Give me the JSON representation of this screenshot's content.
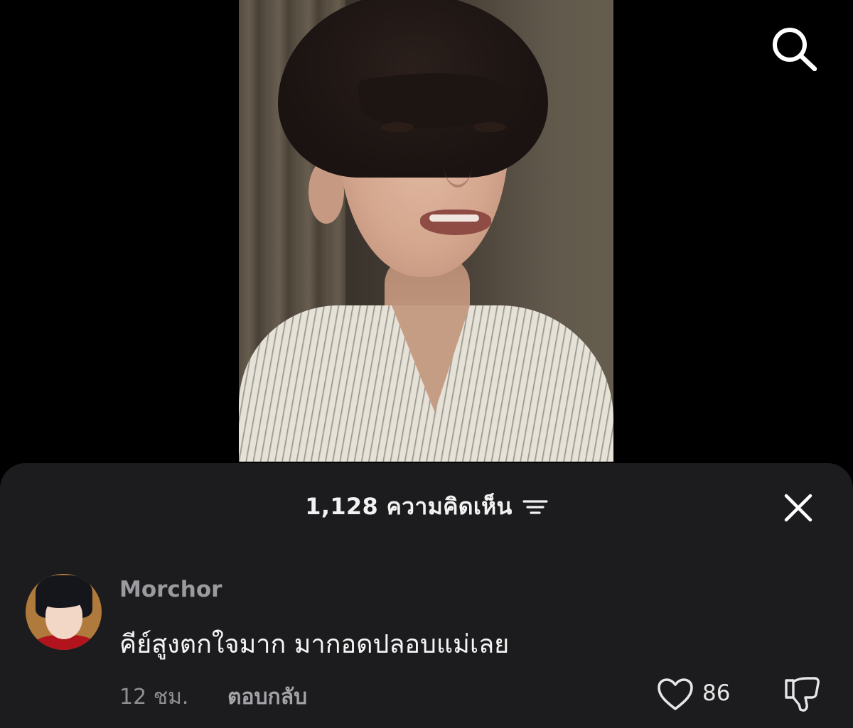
{
  "header": {
    "search_icon": "search-icon"
  },
  "comments_sheet": {
    "title": "1,128 ความคิดเห็น",
    "sort_icon": "sort-lines-icon",
    "close_icon": "close-icon",
    "background": "#1c1c1e"
  },
  "comments": [
    {
      "username": "Morchor",
      "text": "คีย์สูงตกใจมาก มากอดปลอบแม่เลย",
      "time": "12 ชม.",
      "reply_label": "ตอบกลับ",
      "like_count": "86",
      "like_icon": "heart-icon",
      "dislike_icon": "thumbs-down-icon"
    }
  ]
}
